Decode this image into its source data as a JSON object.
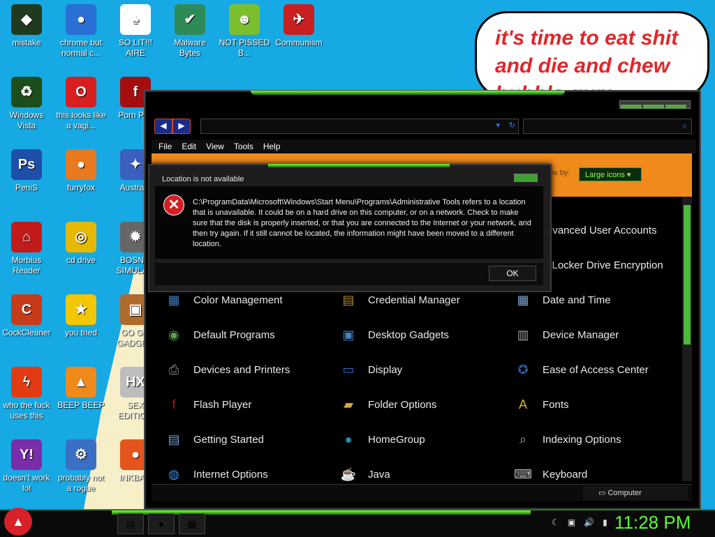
{
  "desktop": {
    "icons": [
      {
        "label": "mistake",
        "glyph": "◆",
        "color": "#1f3a1f"
      },
      {
        "label": "chrome but normal c...",
        "glyph": "●",
        "color": "#2a6fd6"
      },
      {
        "label": "SO LIT!!! AIRE",
        "glyph": "♠",
        "color": "#ffffff"
      },
      {
        "label": "Malware Bytes",
        "glyph": "✔",
        "color": "#2e8b57"
      },
      {
        "label": "NOT PISSED B...",
        "glyph": "☻",
        "color": "#7bbf2f"
      },
      {
        "label": "Communism",
        "glyph": "✈",
        "color": "#c82020"
      },
      {
        "label": "Windows Vista",
        "glyph": "♻",
        "color": "#1c4d1c"
      },
      {
        "label": "this looks like a vagi...",
        "glyph": "O",
        "color": "#d81f1f"
      },
      {
        "label": "Porn Pl...",
        "glyph": "f",
        "color": "#a40e0e"
      },
      {
        "label": "PeniS",
        "glyph": "Ps",
        "color": "#1e4fa8"
      },
      {
        "label": "furryfox",
        "glyph": "●",
        "color": "#e8791e"
      },
      {
        "label": "Austra...",
        "glyph": "✦",
        "color": "#3a5fbf"
      },
      {
        "label": "Morbius Reader",
        "glyph": "⌂",
        "color": "#c21b1b"
      },
      {
        "label": "cd drive",
        "glyph": "◎",
        "color": "#e6b800"
      },
      {
        "label": "BOSN... SIMULA...",
        "glyph": "✹",
        "color": "#666666"
      },
      {
        "label": "CockCleaner",
        "glyph": "C",
        "color": "#c63b1a"
      },
      {
        "label": "you tried",
        "glyph": "★",
        "color": "#f2c600"
      },
      {
        "label": "GO G... GADGE...",
        "glyph": "▣",
        "color": "#b06a2c"
      },
      {
        "label": "who the fuck uses this",
        "glyph": "ϟ",
        "color": "#e23b12"
      },
      {
        "label": "BEEP BEEP",
        "glyph": "▲",
        "color": "#f08a1b"
      },
      {
        "label": "SEX EDITIO...",
        "glyph": "HX",
        "color": "#bdbdbd"
      },
      {
        "label": "doesn't work lol",
        "glyph": "Y!",
        "color": "#7a2da8"
      },
      {
        "label": "probably not a rogue",
        "glyph": "⚙",
        "color": "#3a6fc4"
      },
      {
        "label": "INKBA...",
        "glyph": "●",
        "color": "#e4541c"
      }
    ],
    "bubble_text": "it's time to eat shit and die and chew bubble gum"
  },
  "explorer": {
    "nav_back": "◀",
    "nav_forward": "▶",
    "address": "",
    "search": "",
    "menu": [
      "File",
      "Edit",
      "View",
      "Tools",
      "Help"
    ],
    "view_by": "View by:",
    "view_mode": "Large icons",
    "items": [
      {
        "label": "Color Management",
        "glyph": "▦",
        "color": "#3a7cc4"
      },
      {
        "label": "Credential Manager",
        "glyph": "▤",
        "color": "#b38a2e"
      },
      {
        "label": "Date and Time",
        "glyph": "▦",
        "color": "#7aa7d6"
      },
      {
        "label": "Default Programs",
        "glyph": "◉",
        "color": "#5aa04a"
      },
      {
        "label": "Desktop Gadgets",
        "glyph": "▣",
        "color": "#4a7fc0"
      },
      {
        "label": "Device Manager",
        "glyph": "▥",
        "color": "#9a9a9a"
      },
      {
        "label": "Devices and Printers",
        "glyph": "⎙",
        "color": "#8a8a8a"
      },
      {
        "label": "Display",
        "glyph": "▭",
        "color": "#2f6fc2"
      },
      {
        "label": "Ease of Access Center",
        "glyph": "✪",
        "color": "#2b5fb0"
      },
      {
        "label": "Flash Player",
        "glyph": "f",
        "color": "#b01818"
      },
      {
        "label": "Folder Options",
        "glyph": "▰",
        "color": "#d9a93b"
      },
      {
        "label": "Fonts",
        "glyph": "A",
        "color": "#d6b24a"
      },
      {
        "label": "Getting Started",
        "glyph": "▤",
        "color": "#6a9fd6"
      },
      {
        "label": "HomeGroup",
        "glyph": "●",
        "color": "#1e8fb0"
      },
      {
        "label": "Indexing Options",
        "glyph": "⌕",
        "color": "#8aa0b8"
      },
      {
        "label": "Internet Options",
        "glyph": "◍",
        "color": "#3a8ad6"
      },
      {
        "label": "Java",
        "glyph": "☕",
        "color": "#eeeeee"
      },
      {
        "label": "Keyboard",
        "glyph": "⌨",
        "color": "#bbbbbb"
      }
    ],
    "partial_items": [
      "dvanced User Accounts",
      "itLocker Drive Encryption"
    ],
    "status_location": "Computer"
  },
  "dialog": {
    "title": "Location is not available",
    "message": "C:\\ProgramData\\Microsoft\\Windows\\Start Menu\\Programs\\Administrative Tools refers to a location that is unavailable. It could be on a hard drive on this computer, or on a network. Check to make sure that the disk is properly inserted, or that you are connected to the Internet or your network, and then try again. If it still cannot be located, the information might have been moved to a different location.",
    "ok_label": "OK",
    "error_glyph": "✕"
  },
  "taskbar": {
    "clock": "11:28 PM",
    "tray_icons": [
      "☾",
      "▣",
      "🔊",
      "▮"
    ]
  }
}
